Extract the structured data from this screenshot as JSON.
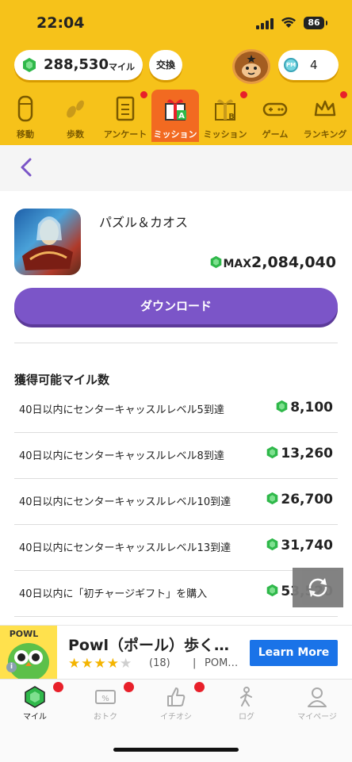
{
  "status_bar": {
    "time": "22:04",
    "battery": "86"
  },
  "header": {
    "miles": "288,530",
    "miles_unit": "マイル",
    "exchange_label": "交換",
    "coin_count": "4",
    "coin_label": "PM"
  },
  "tabs": [
    {
      "label": "移動",
      "icon": "capsule-icon"
    },
    {
      "label": "歩数",
      "icon": "footprints-icon"
    },
    {
      "label": "アンケート",
      "icon": "clipboard-icon"
    },
    {
      "label": "ミッション",
      "icon": "gift-a-icon"
    },
    {
      "label": "ミッション",
      "icon": "gift-b-icon"
    },
    {
      "label": "ゲーム",
      "icon": "gamepad-icon"
    },
    {
      "label": "ランキング",
      "icon": "crown-icon"
    }
  ],
  "app": {
    "name": "パズル＆カオス",
    "max_label": "MAX",
    "max_value": "2,084,040",
    "download_label": "ダウンロード"
  },
  "section_title": "獲得可能マイル数",
  "rewards": [
    {
      "desc": "40日以内にセンターキャッスルレベル5到達",
      "miles": "8,100"
    },
    {
      "desc": "40日以内にセンターキャッスルレベル8到達",
      "miles": "13,260"
    },
    {
      "desc": "40日以内にセンターキャッスルレベル10到達",
      "miles": "26,700"
    },
    {
      "desc": "40日以内にセンターキャッスルレベル13到達",
      "miles": "31,740"
    },
    {
      "desc": "40日以内に「初チャージギフト」を購入",
      "miles": "53,520"
    }
  ],
  "ad": {
    "brand": "POWL",
    "title": "Powl（ポール）歩く…",
    "stars": "★★★★",
    "star_off": "★",
    "rating_count": "(18)",
    "separator": "|",
    "publisher": "POM…",
    "cta": "Learn More",
    "info": "i"
  },
  "bottom_nav": [
    {
      "label": "マイル"
    },
    {
      "label": "おトク"
    },
    {
      "label": "イチオシ"
    },
    {
      "label": "ログ"
    },
    {
      "label": "マイページ"
    }
  ],
  "colors": {
    "header_bg": "#f6c21a",
    "active_tab": "#f26a21",
    "accent_purple": "#7b55c8",
    "gem_green": "#2fb84a",
    "badge_red": "#e8202a",
    "ad_button": "#1a73e8"
  }
}
